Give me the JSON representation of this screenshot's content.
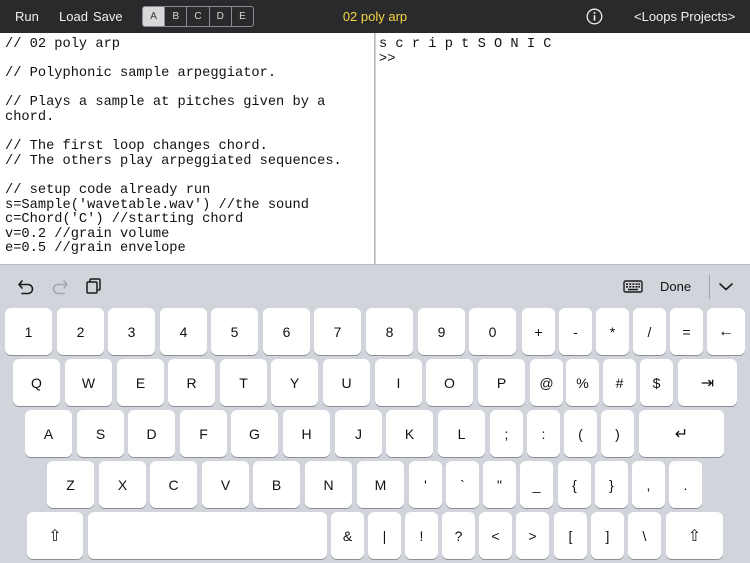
{
  "toolbar": {
    "run": "Run",
    "load": "Load",
    "save": "Save",
    "segments": [
      "A",
      "B",
      "C",
      "D",
      "E"
    ],
    "active_segment": "A",
    "title": "02 poly arp",
    "nav_links": "<Loops  Projects>"
  },
  "editor": {
    "code": "// 02 poly arp\n\n// Polyphonic sample arpeggiator.\n\n// Plays a sample at pitches given by a\nchord.\n\n// The first loop changes chord.\n// The others play arpeggiated sequences.\n\n// setup code already run\ns=Sample('wavetable.wav') //the sound\nc=Chord('C') //starting chord\nv=0.2 //grain volume\ne=0.5 //grain envelope"
  },
  "console": {
    "text": "s c r i p t S O N I C\n>>"
  },
  "keyboard_toolbar": {
    "done": "Done"
  },
  "keyboard": {
    "row1": [
      "1",
      "2",
      "3",
      "4",
      "5",
      "6",
      "7",
      "8",
      "9",
      "0",
      "+",
      "-",
      "*",
      "/",
      "=",
      "←"
    ],
    "row2": [
      "Q",
      "W",
      "E",
      "R",
      "T",
      "Y",
      "U",
      "I",
      "O",
      "P",
      "@",
      "%",
      "#",
      "$",
      "⇥"
    ],
    "row3": [
      "A",
      "S",
      "D",
      "F",
      "G",
      "H",
      "J",
      "K",
      "L",
      ";",
      ":",
      "(",
      ")",
      "↵"
    ],
    "row4": [
      "Z",
      "X",
      "C",
      "V",
      "B",
      "N",
      "M",
      "'",
      "`",
      "\"",
      "_",
      "{",
      "}",
      ",",
      "."
    ],
    "row5": [
      "⇧",
      "",
      "&",
      "|",
      "!",
      "?",
      "<",
      ">",
      "[",
      "]",
      "\\",
      "⇧"
    ]
  },
  "colors": {
    "topbar_bg": "#2a2a2c",
    "title_color": "#f5d742",
    "keyboard_bg": "#d1d4da",
    "key_bg": "#ffffff"
  },
  "icons": [
    "info-icon",
    "undo-icon",
    "redo-icon",
    "paste-icon",
    "keyboard-icon",
    "chevron-down-icon"
  ]
}
